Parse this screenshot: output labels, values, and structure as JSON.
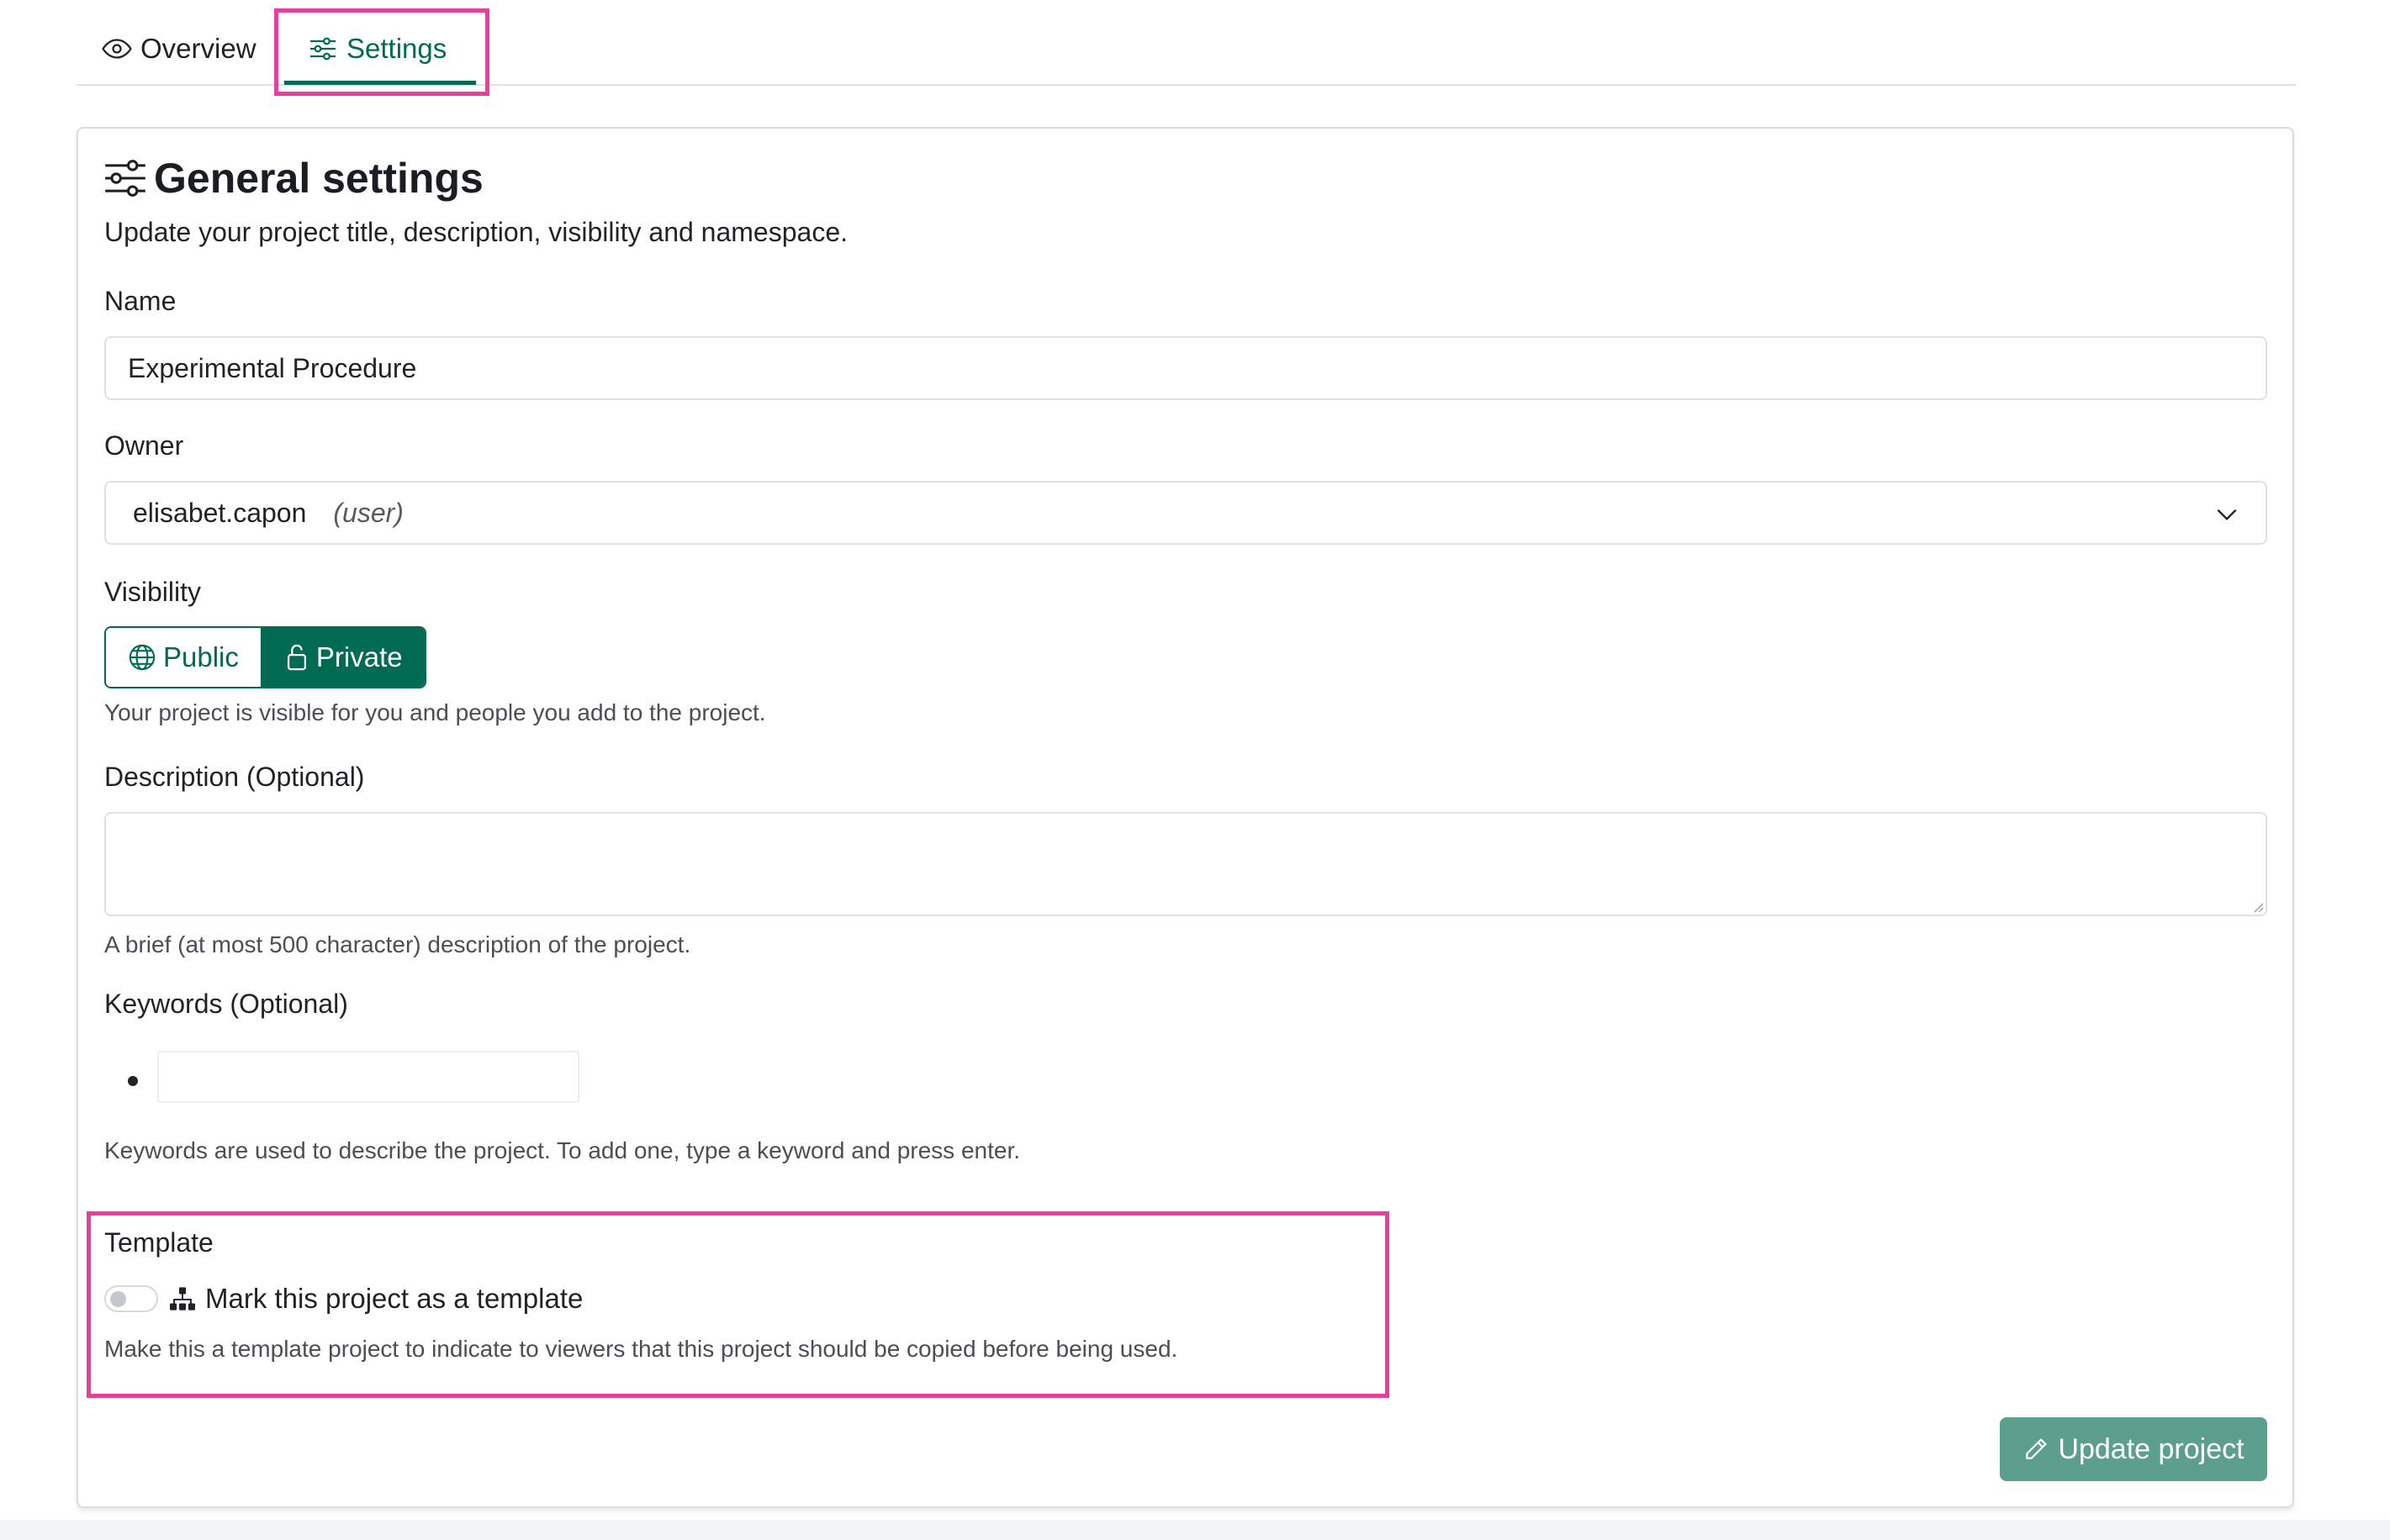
{
  "tabs": {
    "overview_label": "Overview",
    "settings_label": "Settings",
    "active": "Settings"
  },
  "general": {
    "title": "General settings",
    "subtitle": "Update your project title, description, visibility and namespace."
  },
  "name_field": {
    "label": "Name",
    "value": "Experimental Procedure"
  },
  "owner_field": {
    "label": "Owner",
    "value": "elisabet.capon",
    "type": "(user)"
  },
  "visibility": {
    "label": "Visibility",
    "options": [
      "Public",
      "Private"
    ],
    "selected": "Private",
    "help": "Your project is visible for you and people you add to the project."
  },
  "description_field": {
    "label": "Description (Optional)",
    "value": "",
    "help": "A brief (at most 500 character) description of the project."
  },
  "keywords": {
    "label": "Keywords (Optional)",
    "value": "",
    "help": "Keywords are used to describe the project. To add one, type a keyword and press enter."
  },
  "template": {
    "label": "Template",
    "toggle_label": "Mark this project as a template",
    "enabled": false,
    "help": "Make this a template project to indicate to viewers that this project should be copied before being used."
  },
  "actions": {
    "update_label": "Update project"
  },
  "icons": [
    "eye-icon",
    "sliders-icon",
    "globe-icon",
    "lock-icon",
    "chevron-down-icon",
    "diagram-icon",
    "pencil-icon"
  ],
  "colors": {
    "accent": "#006b52",
    "button_disabled": "#5c9f8e",
    "highlight": "#e83e9e"
  }
}
